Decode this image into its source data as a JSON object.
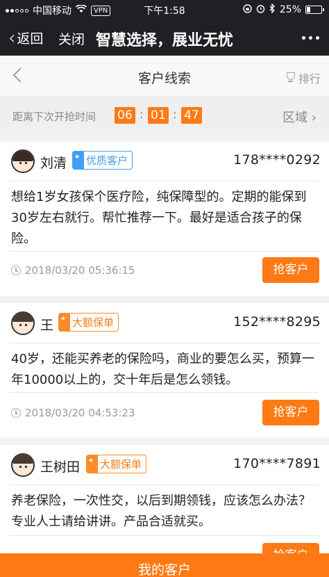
{
  "status_bar": {
    "carrier": "中国移动",
    "vpn": "VPN",
    "time": "下午1:58",
    "battery": "25%"
  },
  "nav": {
    "back_label": "返回",
    "close_label": "关闭",
    "title": "智慧选择，展业无忧"
  },
  "header": {
    "title": "客户线索",
    "rank_label": "排行"
  },
  "countdown": {
    "label": "距离下次开抢时间",
    "hours": "06",
    "minutes": "01",
    "seconds": "47",
    "region_label": "区域"
  },
  "leads": [
    {
      "name": "刘清",
      "badge": "优质客户",
      "phone": "178****0292",
      "text": "想给1岁女孩保个医疗险，纯保障型的。定期的能保到30岁左右就行。帮忙推荐一下。最好是适合孩子的保险。",
      "time": "2018/03/20 05:36:15",
      "button": "抢客户"
    },
    {
      "name": "王",
      "badge": "大额保单",
      "phone": "152****8295",
      "text": "40岁，还能买养老的保险吗，商业的要怎么买，预算一年10000以上的，交十年后是怎么领钱。",
      "time": "2018/03/20 04:53:23",
      "button": "抢客户"
    },
    {
      "name": "王树田",
      "badge": "大额保单",
      "phone": "170****7891",
      "text": "养老保险，一次性交，以后到期领钱，应该怎么办法？专业人士请给讲讲。产品合适就买。",
      "time": "",
      "button": "抢客户"
    }
  ],
  "bottom": {
    "label": "我的客户"
  },
  "colors": {
    "accent": "#ff7a14",
    "badge_blue": "#3ea0f5",
    "nav_bg": "#1f2024"
  }
}
